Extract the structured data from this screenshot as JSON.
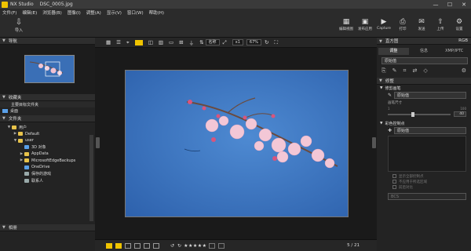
{
  "app": {
    "title": "NX Studio",
    "filename": "DSC_0005.jpg"
  },
  "window_controls": [
    "—",
    "☐",
    "✕"
  ],
  "menu": [
    "文件(F)",
    "编辑(E)",
    "浏览器(B)",
    "图像(I)",
    "调整(A)",
    "显示(V)",
    "窗口(W)",
    "帮助(H)"
  ],
  "toolbar": {
    "import": "导入",
    "right": [
      "编辑视图",
      "发布应用",
      "Capture",
      "打印",
      "发送",
      "上传",
      "设置"
    ]
  },
  "left": {
    "nav_title": "导航",
    "fav_title": "收藏夹",
    "fav_items": [
      "主要目标文件夹",
      "桌面"
    ],
    "folder_title": "文件夹",
    "tree": [
      {
        "label": "用户",
        "indent": 1,
        "icon": "folder"
      },
      {
        "label": "Default",
        "indent": 2,
        "icon": "folder"
      },
      {
        "label": "user",
        "indent": 2,
        "icon": "folder"
      },
      {
        "label": "3D 对象",
        "indent": 3,
        "icon": "blue"
      },
      {
        "label": "AppData",
        "indent": 3,
        "icon": "folder"
      },
      {
        "label": "MicrosoftEdgeBackups",
        "indent": 3,
        "icon": "folder"
      },
      {
        "label": "OneDrive",
        "indent": 3,
        "icon": "blue"
      },
      {
        "label": "保存的游戏",
        "indent": 3,
        "icon": "gray"
      },
      {
        "label": "联系人",
        "indent": 3,
        "icon": "gray"
      }
    ],
    "bottom_title": "相册"
  },
  "center": {
    "sort": "名称",
    "zoom_prefix": "x1",
    "zoom": "67%",
    "page": "5 / 21",
    "rating": "★★★★★"
  },
  "right": {
    "hist_title": "直方图",
    "hist_mode": "RGB",
    "tabs": [
      "调整",
      "信息",
      "XMP/IPTC"
    ],
    "preset": "原始值",
    "section1": "修整",
    "sub1": "修剪画笔",
    "sub1_val": "原始值",
    "sub1_label": "画笔尺寸",
    "slider_val": "40",
    "slider_min": "1",
    "slider_max": "100",
    "section2": "彩色控制点",
    "sub2_val": "原始值",
    "checks": [
      "显示全部控制点",
      "不应用于所选区域",
      "前后对比"
    ],
    "bottom_sel": "BCS"
  },
  "colors": {
    "accent": "#f0c400",
    "sky": "#3d78c4"
  }
}
